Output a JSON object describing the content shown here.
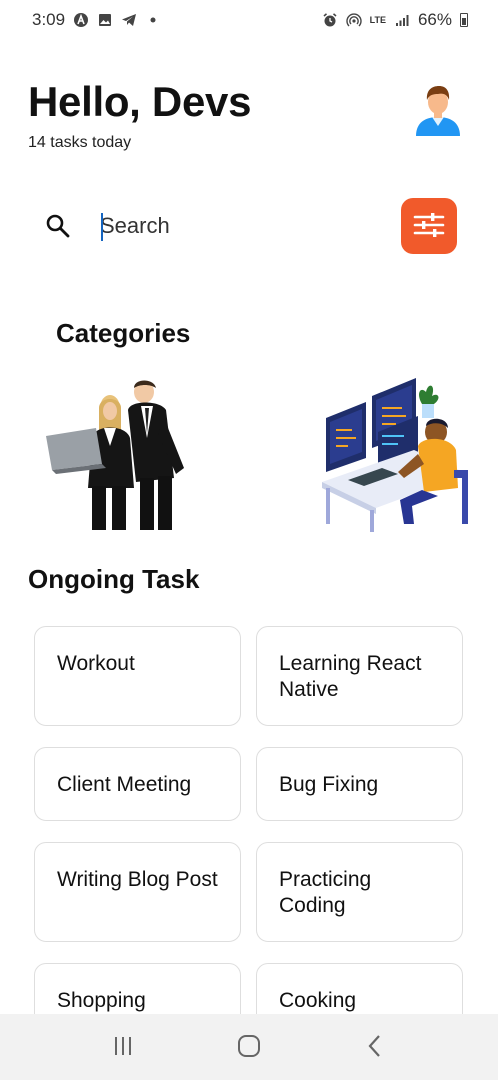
{
  "status_bar": {
    "time": "3:09",
    "battery": "66%",
    "network": "LTE"
  },
  "header": {
    "greeting": "Hello, Devs",
    "subtitle": "14 tasks today",
    "avatar_icon": "user-avatar-icon"
  },
  "search": {
    "placeholder": "Search",
    "icon": "search-icon"
  },
  "filter": {
    "icon": "sliders-icon",
    "color": "#f15a2b"
  },
  "categories": {
    "title": "Categories",
    "items": [
      {
        "icon": "business-people-illustration"
      },
      {
        "icon": "developer-workstation-illustration"
      }
    ]
  },
  "ongoing": {
    "title": "Ongoing Task",
    "tasks": [
      {
        "label": "Workout"
      },
      {
        "label": "Learning React Native"
      },
      {
        "label": "Client Meeting"
      },
      {
        "label": "Bug Fixing"
      },
      {
        "label": "Writing Blog Post"
      },
      {
        "label": "Practicing Coding"
      },
      {
        "label": "Shopping"
      },
      {
        "label": "Cooking"
      }
    ]
  },
  "nav": {
    "recents_icon": "recents-icon",
    "home_icon": "home-icon",
    "back_icon": "back-icon"
  }
}
